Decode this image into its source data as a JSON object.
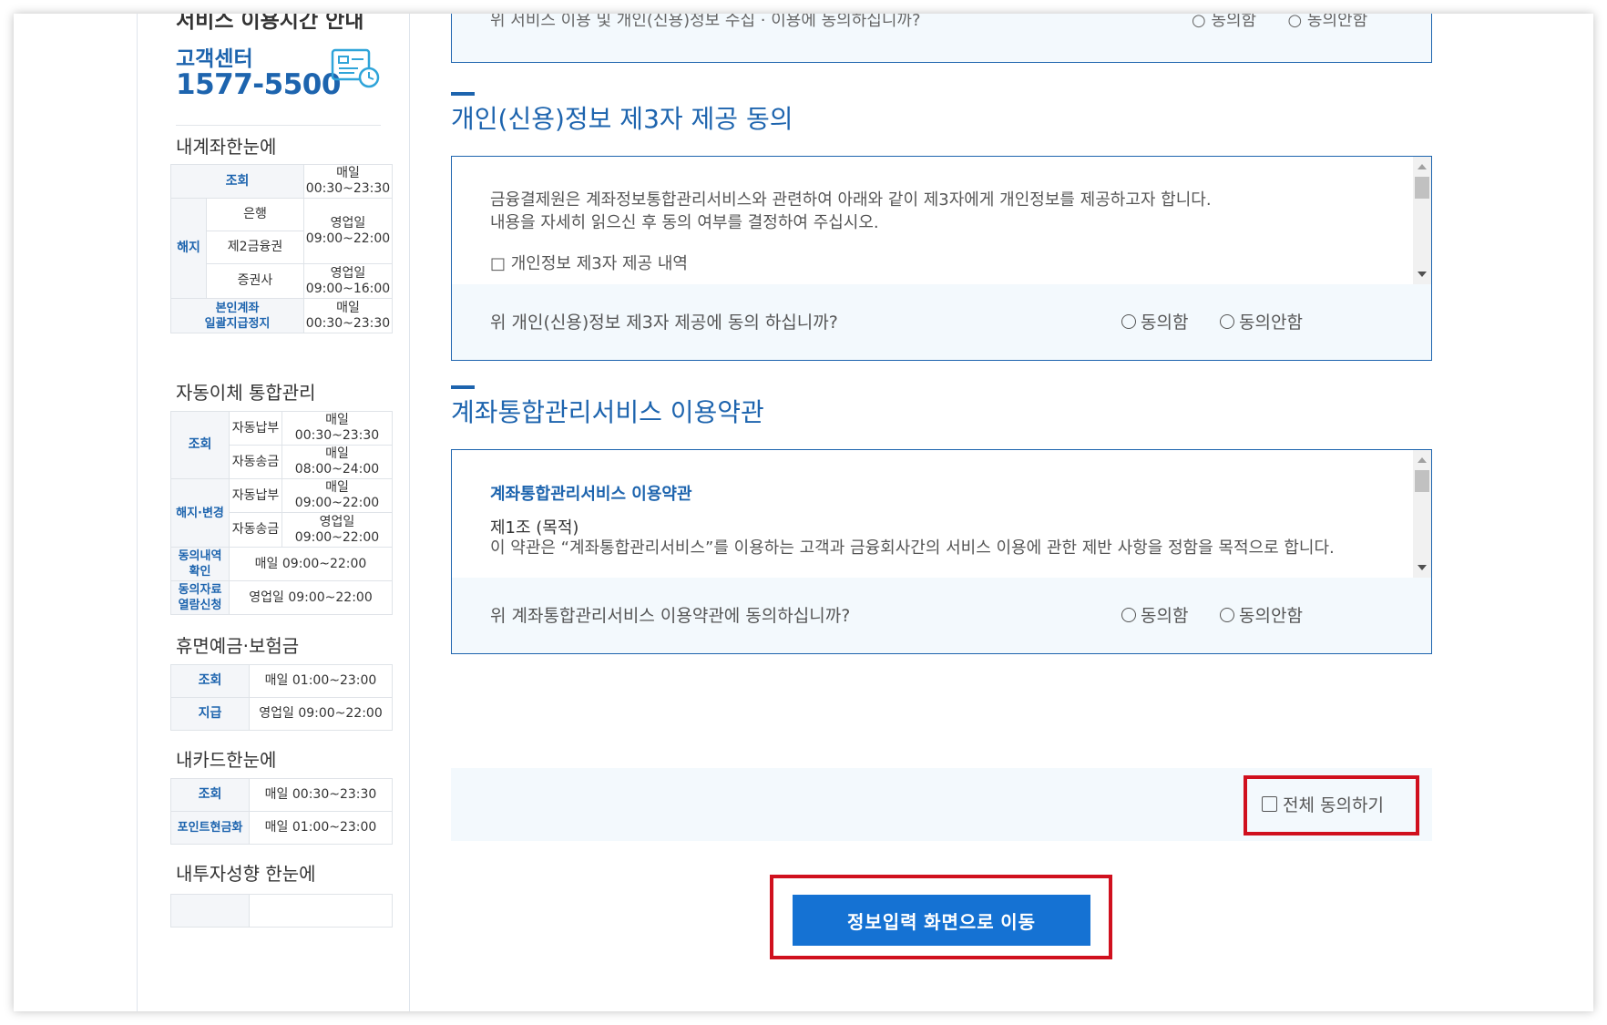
{
  "sidebar": {
    "cut_title": "서비스 이용시간 안내",
    "customer_center_label": "고객센터",
    "customer_center_phone": "1577-5500",
    "sections": {
      "my_account": {
        "heading": "내계좌한눈에",
        "rows": [
          {
            "cat": "조회",
            "sub": "",
            "time": "매일\n00:30~23:30"
          },
          {
            "cat": "해지",
            "sub": "은행",
            "time": "영업일\n09:00~22:00"
          },
          {
            "cat": "",
            "sub": "제2금융권",
            "time": ""
          },
          {
            "cat": "",
            "sub": "증권사",
            "time": "영업일\n09:00~16:00"
          },
          {
            "cat": "본인계좌\n일괄지급정지",
            "sub": "",
            "time": "매일\n00:30~23:30"
          }
        ]
      },
      "auto_transfer": {
        "heading": "자동이체 통합관리",
        "rows": [
          {
            "cat": "조회",
            "sub": "자동납부",
            "time": "매일\n00:30~23:30"
          },
          {
            "cat": "",
            "sub": "자동송금",
            "time": "매일\n08:00~24:00"
          },
          {
            "cat": "해지·변경",
            "sub": "자동납부",
            "time": "매일\n09:00~22:00"
          },
          {
            "cat": "",
            "sub": "자동송금",
            "time": "영업일\n09:00~22:00"
          },
          {
            "cat": "동의내역\n확인",
            "sub": "",
            "time": "매일 09:00~22:00"
          },
          {
            "cat": "동의자료\n열람신청",
            "sub": "",
            "time": "영업일 09:00~22:00"
          }
        ]
      },
      "dormant": {
        "heading": "휴면예금·보험금",
        "rows": [
          {
            "cat": "조회",
            "time": "매일 01:00~23:00"
          },
          {
            "cat": "지급",
            "time": "영업일 09:00~22:00"
          }
        ]
      },
      "my_card": {
        "heading": "내카드한눈에",
        "rows": [
          {
            "cat": "조회",
            "time": "매일 00:30~23:30"
          },
          {
            "cat": "포인트현금화",
            "time": "매일 01:00~23:00"
          }
        ]
      },
      "my_invest": {
        "heading": "내투자성향 한눈에"
      }
    }
  },
  "main": {
    "top_box": {
      "question_cut": "위 서비스 이용 및 개인(신용)정보 수집 · 이용에 동의하십니까?",
      "agree": "동의함",
      "disagree": "동의안함"
    },
    "third_party": {
      "title": "개인(신용)정보 제3자 제공 동의",
      "line1": "금융결제원은 계좌정보통합관리서비스와 관련하여 아래와 같이 제3자에게 개인정보를 제공하고자 합니다.",
      "line2": "내용을 자세히 읽으신 후 동의 여부를 결정하여 주십시오.",
      "line3": "□ 개인정보 제3자 제공 내역",
      "question": "위 개인(신용)정보 제3자 제공에 동의 하십니까?",
      "agree": "동의함",
      "disagree": "동의안함"
    },
    "terms": {
      "title": "계좌통합관리서비스 이용약관",
      "inner_title": "계좌통합관리서비스 이용약관",
      "article_title": "제1조 (목적)",
      "article_text": "이 약관은 “계좌통합관리서비스”를 이용하는 고객과 금융회사간의 서비스 이용에 관한 제반 사항을 정함을 목적으로 합니다.",
      "question": "위 계좌통합관리서비스 이용약관에 동의하십니까?",
      "agree": "동의함",
      "disagree": "동의안함"
    },
    "agree_all_label": "전체 동의하기",
    "next_button": "정보입력 화면으로 이동"
  },
  "colors": {
    "brand_blue": "#1d64ae",
    "button_blue": "#1572d3",
    "highlight_red": "#d0101e",
    "panel_bg": "#f3f9fd"
  }
}
